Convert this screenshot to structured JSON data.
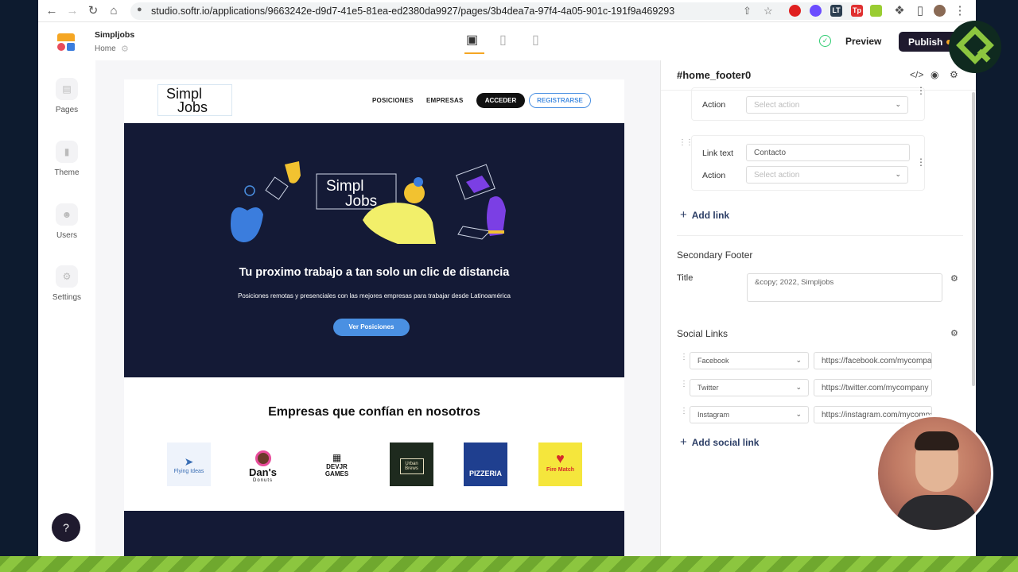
{
  "browser": {
    "url": "studio.softr.io/applications/9663242e-d9d7-41e5-81ea-ed2380da9927/pages/3b4dea7a-97f4-4a05-901c-191f9a469293",
    "extensions": [
      "opera-icon",
      "chatgpt-icon",
      "lt-icon",
      "tp-icon",
      "bolt-icon",
      "puzzle-icon"
    ],
    "ext_labels": [
      "",
      "",
      "LT",
      "Tp",
      "",
      ""
    ]
  },
  "topbar": {
    "app_name": "Simpljobs",
    "page_name": "Home",
    "preview_label": "Preview",
    "publish_label": "Publish"
  },
  "sidebar": {
    "items": [
      {
        "label": "Pages"
      },
      {
        "label": "Theme"
      },
      {
        "label": "Users"
      },
      {
        "label": "Settings"
      }
    ],
    "help_label": "?"
  },
  "site": {
    "logo_line1": "Simpl",
    "logo_line2": "Jobs",
    "nav": {
      "posiciones": "POSICIONES",
      "empresas": "EMPRESAS",
      "acceder": "ACCEDER",
      "registrarse": "REGISTRARSE"
    },
    "hero": {
      "art_line1": "Simpl",
      "art_line2": "Jobs",
      "title": "Tu proximo trabajo a tan solo un clic de distancia",
      "subtitle": "Posiciones remotas y presenciales con las mejores empresas para trabajar desde Latinoamérica",
      "button": "Ver Posiciones"
    },
    "companies_title": "Empresas que confían en nosotros",
    "companies": [
      {
        "name": "Flying Ideas"
      },
      {
        "name": "Dan's Donuts",
        "line1": "Dan's",
        "line2": "Donuts"
      },
      {
        "name": "DEVJR GAMES",
        "line1": "DEVJR",
        "line2": "GAMES"
      },
      {
        "name": "Urban Brews"
      },
      {
        "name": "PIZZERIA"
      },
      {
        "name": "Fire Match"
      }
    ]
  },
  "panel": {
    "title": "#home_footer0",
    "link1": {
      "action_label": "Action",
      "action_placeholder": "Select action"
    },
    "link2": {
      "link_text_label": "Link text",
      "link_text_value": "Contacto",
      "action_label": "Action",
      "action_placeholder": "Select action"
    },
    "add_link": "Add link",
    "secondary_footer": {
      "title": "Secondary Footer",
      "title_label": "Title",
      "title_value": "&copy; 2022, Simpljobs"
    },
    "social_links": {
      "title": "Social Links",
      "items": [
        {
          "network": "Facebook",
          "url": "https://facebook.com/mycompany"
        },
        {
          "network": "Twitter",
          "url": "https://twitter.com/mycompany"
        },
        {
          "network": "Instagram",
          "url": "https://instagram.com/mycompany"
        }
      ],
      "add_label": "Add social link"
    }
  },
  "colors": {
    "accent_blue": "#4a90e2",
    "hero_bg": "#141a36",
    "publish_bg": "#1f1a2e",
    "publish_dot": "#f5a623",
    "saved_green": "#2ecc71"
  }
}
